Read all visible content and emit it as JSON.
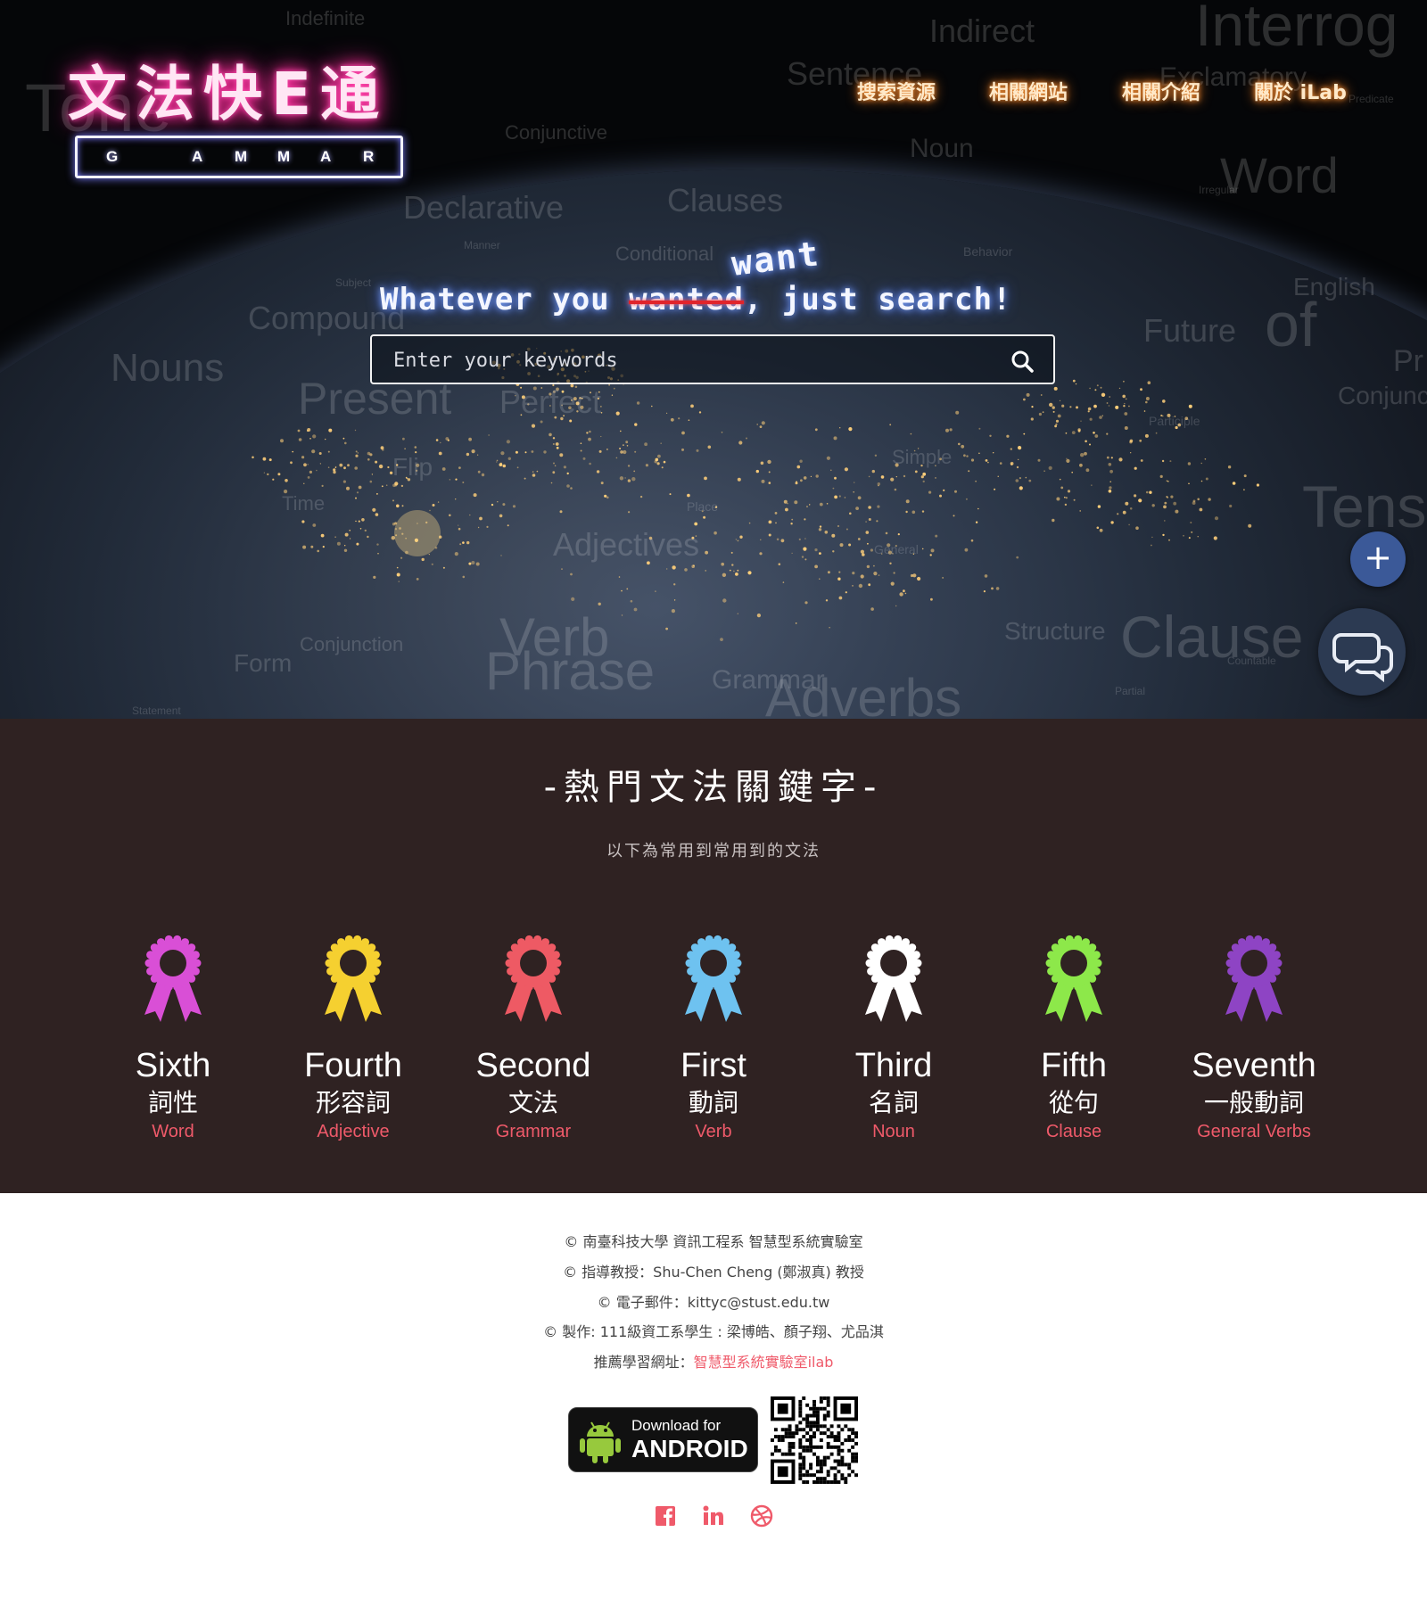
{
  "hero": {
    "logo": {
      "title": "文法快E通",
      "letters": [
        "G",
        "A",
        "M",
        "M",
        "A",
        "R"
      ]
    },
    "nav": [
      {
        "label": "搜索資源"
      },
      {
        "label": "相關網站"
      },
      {
        "label": "相關介紹"
      },
      {
        "label": "關於 iLab"
      }
    ],
    "tagline": {
      "before": "Whatever you ",
      "struck": "wanted",
      "after": ", just search!",
      "correction": "want"
    },
    "search": {
      "placeholder": "Enter your keywords",
      "value": ""
    },
    "background_words": [
      "Indefinite",
      "Indirect",
      "Interrog",
      "Tone",
      "Sentence",
      "Exclamatory",
      "Conjunctive",
      "Noun",
      "Predicate",
      "Word",
      "Irregular",
      "Declarative",
      "Clauses",
      "Manner",
      "Conditional",
      "Behavior",
      "English",
      "Subject",
      "Compound",
      "Future",
      "of",
      "Pr",
      "Nouns",
      "Present",
      "Perfect",
      "Conjunc",
      "Participle",
      "Flip",
      "Simple",
      "Time",
      "Tens",
      "Adjectives",
      "Place",
      "General",
      "Verb",
      "Phrase",
      "Structure",
      "Clause",
      "Conjunction",
      "Form",
      "Grammar",
      "Adverbs",
      "Countable",
      "Partial",
      "Statement"
    ]
  },
  "fab": {
    "plus": "+"
  },
  "keywords": {
    "title": "-熱門文法關鍵字-",
    "subtitle": "以下為常用到常用到的文法",
    "items": [
      {
        "rank": "Sixth",
        "zh": "詞性",
        "en": "Word",
        "color": "#d94fd6"
      },
      {
        "rank": "Fourth",
        "zh": "形容詞",
        "en": "Adjective",
        "color": "#f5d030"
      },
      {
        "rank": "Second",
        "zh": "文法",
        "en": "Grammar",
        "color": "#ee5a64"
      },
      {
        "rank": "First",
        "zh": "動詞",
        "en": "Verb",
        "color": "#6ec2f0"
      },
      {
        "rank": "Third",
        "zh": "名詞",
        "en": "Noun",
        "color": "#ffffff"
      },
      {
        "rank": "Fifth",
        "zh": "從句",
        "en": "Clause",
        "color": "#8de84a"
      },
      {
        "rank": "Seventh",
        "zh": "一般動詞",
        "en": "General Verbs",
        "color": "#8e44c4"
      }
    ]
  },
  "footer": {
    "lines": [
      "© 南臺科技大學 資訊工程系 智慧型系統實驗室",
      "© 指導教授：Shu-Chen Cheng (鄭淑真) 教授",
      "© 電子郵件：kittyc@stust.edu.tw",
      "© 製作: 111級資工系學生 : 梁博皓、顏子翔、尤品淇"
    ],
    "recommend_prefix": "推薦學習網址：",
    "recommend_link": "智慧型系統實驗室ilab",
    "android": {
      "small": "Download for",
      "big": "ANDROID"
    },
    "social": [
      "facebook-icon",
      "linkedin-icon",
      "dribbble-icon"
    ],
    "accent_color": "#ef5a6a"
  }
}
